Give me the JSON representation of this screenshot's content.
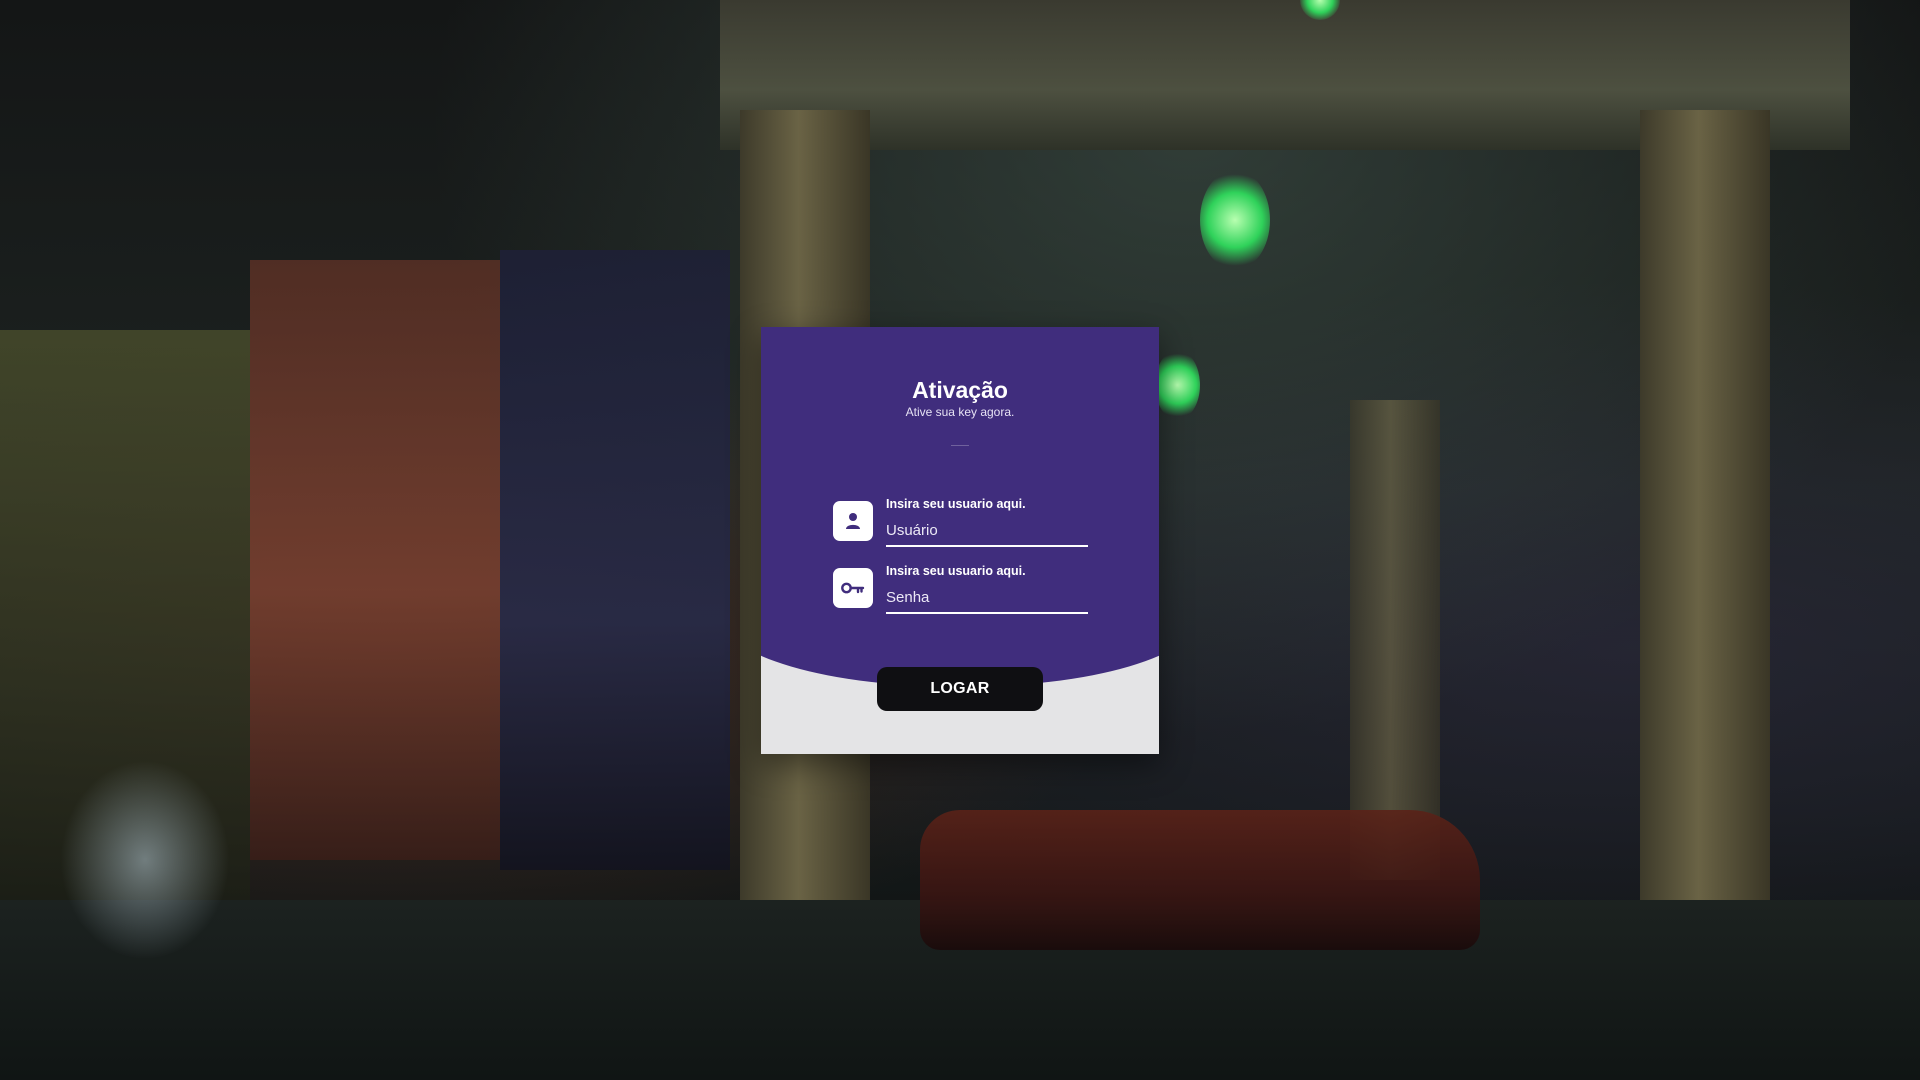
{
  "login": {
    "title": "Ativação",
    "subtitle": "Ative sua key agora.",
    "username": {
      "label": "Insira seu usuario aqui.",
      "placeholder": "Usuário",
      "value": "",
      "icon": "user-icon"
    },
    "password": {
      "label": "Insira seu usuario aqui.",
      "placeholder": "Senha",
      "value": "",
      "icon": "key-icon"
    },
    "submit_label": "LOGAR"
  },
  "colors": {
    "card_primary": "#402d7d",
    "card_secondary": "#e4e4e6",
    "button_bg": "#0f0f12",
    "text_light": "#ffffff"
  }
}
